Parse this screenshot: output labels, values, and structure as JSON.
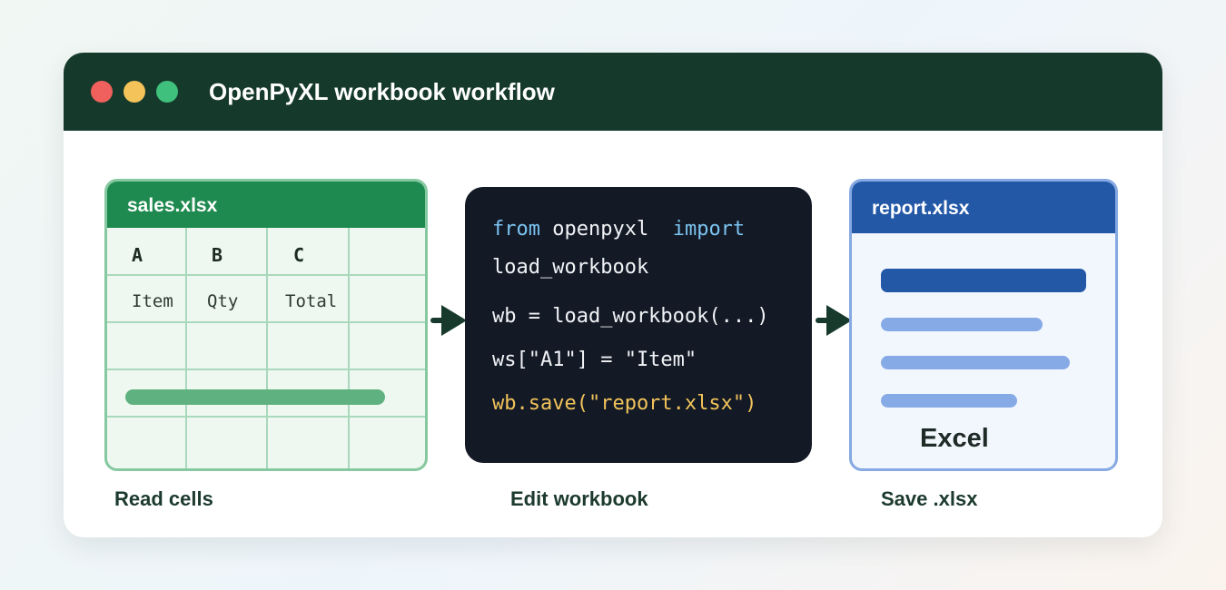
{
  "window": {
    "title": "OpenPyXL workbook workflow"
  },
  "source_sheet": {
    "filename": "sales.xlsx",
    "columns": [
      "A",
      "B",
      "C"
    ],
    "row1": [
      "Item",
      "Qty",
      "Total"
    ]
  },
  "code": {
    "line1_kw1": "from",
    "line1_mod": "openpyxl",
    "line1_kw2": "import",
    "line2": "load_workbook",
    "line3": "wb = load_workbook(...)",
    "line4": "ws[\"A1\"] = \"Item\"",
    "line5": "wb.save(\"report.xlsx\")"
  },
  "report": {
    "filename": "report.xlsx",
    "label": "Excel"
  },
  "steps": [
    {
      "caption": "Read cells"
    },
    {
      "caption": "Edit workbook"
    },
    {
      "caption": "Save .xlsx"
    }
  ],
  "colors": {
    "titlebar": "#15392b",
    "sheet_green": "#1f8a50",
    "report_blue": "#2358a7",
    "code_bg": "#131a26",
    "keyword": "#7cc4f2",
    "string": "#f2c35a"
  },
  "icons": [
    "close-dot-icon",
    "minimize-dot-icon",
    "maximize-dot-icon",
    "arrow-right-icon"
  ]
}
